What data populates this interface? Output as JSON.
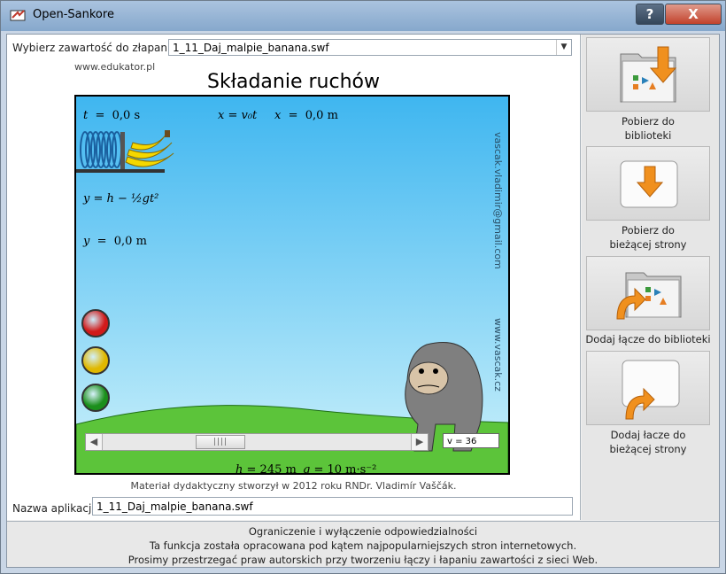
{
  "window": {
    "title": "Open-Sankore",
    "help_label": "?",
    "close_label": "X"
  },
  "capture": {
    "label": "Wybierz zawartość do złapania",
    "selected": "1_11_Daj_malpie_banana.swf"
  },
  "simulation": {
    "site": "www.edukator.pl",
    "title": "Składanie ruchów",
    "side_email": "vascak.vladimir@gmail.com",
    "side_site": "www.vascak.cz",
    "t_label": "t",
    "t_value": "0,0 s",
    "x_eq": "x = v₀t",
    "x_label": "x",
    "x_value": "0,0 m",
    "y_eq": "y = h − ½gt²",
    "y_label": "y",
    "y_value": "0,0 m",
    "v0_label": "v₀",
    "v0_value": "36 m·s⁻¹",
    "h_label": "h",
    "h_value": "245 m",
    "g_label": "g",
    "g_value": "10 m·s⁻²",
    "v_box": "v = 36",
    "slider_fraction": 0.36,
    "buttons": [
      {
        "name": "red-button",
        "color": "#d11a1a"
      },
      {
        "name": "yellow-button",
        "color": "#e0b800"
      },
      {
        "name": "green-button",
        "color": "#1b8f1b"
      }
    ],
    "credit": "Materiał dydaktyczny stworzył w 2012 roku RNDr. Vladimír Vaščák."
  },
  "app_name": {
    "label": "Nazwa aplikacji",
    "value": "1_11_Daj_malpie_banana.swf"
  },
  "actions": [
    {
      "label_line1": "Pobierz do",
      "label_line2": "biblioteki"
    },
    {
      "label_line1": "Pobierz do",
      "label_line2": "bieżącej strony"
    },
    {
      "label_line1": "Dodaj łącze do biblioteki",
      "label_line2": ""
    },
    {
      "label_line1": "Dodaj łacze do",
      "label_line2": "bieżącej strony"
    }
  ],
  "footer": {
    "line1": "Ograniczenie i wyłączenie odpowiedzialności",
    "line2": "Ta funkcja została opracowana pod kątem najpopularniejszych stron internetowych.",
    "line3": "Prosimy przestrzegać praw autorskich przy tworzeniu łączy i łapaniu zawartości z sieci Web."
  },
  "colors": {
    "accent": "#f0901e",
    "sky": "#3fb6f0",
    "grass": "#5cc43a"
  }
}
